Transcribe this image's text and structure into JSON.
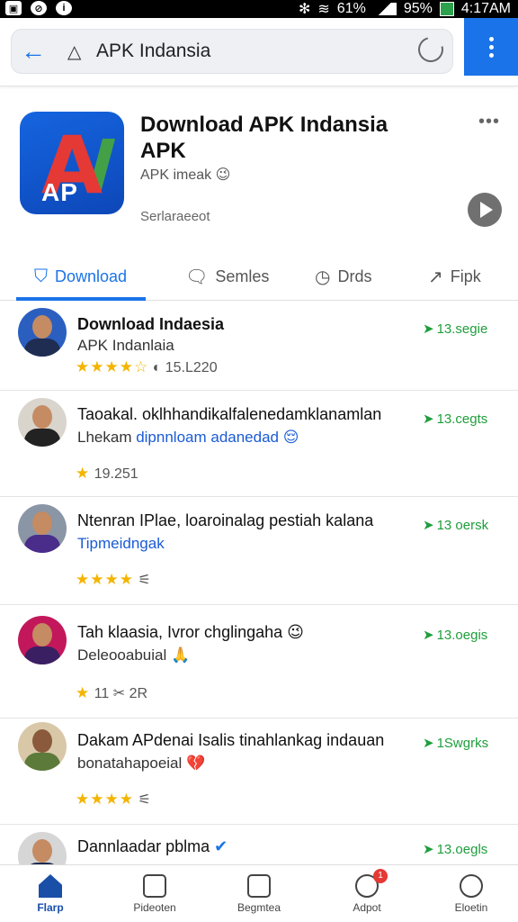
{
  "status_bar": {
    "battery_left": "61%",
    "battery": "95%",
    "time": "4:17AM"
  },
  "urlbar": {
    "url": "APK Indansia"
  },
  "app": {
    "title": "Download APK Indansia APK",
    "subtitle": "APK imeak 😉",
    "developer": "Serlaraeeot",
    "logo_text": "AP"
  },
  "tabs": [
    {
      "label": "Download"
    },
    {
      "label": "Semles"
    },
    {
      "label": "Drds"
    },
    {
      "label": "Fipk"
    }
  ],
  "list": [
    {
      "title": "Download Indaesia",
      "subtitle": "APK Indanlaia",
      "subtitle_blue": "",
      "stars": "★★★★☆",
      "rating": "◐ 15.L220",
      "count": "13.segie"
    },
    {
      "title": "Taoakal. oklhhandikalfalenedamklanamlan",
      "subtitle": "Lhekam ",
      "subtitle_blue": "dipnnloam adanedad 😌",
      "stars": "★",
      "rating": "19.251",
      "count": "13.cegts"
    },
    {
      "title": "Ntenran IPlae, loaroinalag pestiah kalana",
      "subtitle": "",
      "subtitle_blue": "Tipmeidngak",
      "stars": "★★★★",
      "rating": "⚟",
      "count": "13 oersk"
    },
    {
      "title": "Tah klaasia, Ivror chglingaha 😉",
      "subtitle": "Deleooabuial 🙏",
      "subtitle_blue": "",
      "stars": "★",
      "rating": "11 ✂ 2R",
      "count": "13.oegis"
    },
    {
      "title": "Dakam APdenai Isalis tinahlankag indauan",
      "subtitle": "bonatahapoeial 💔",
      "subtitle_blue": "",
      "stars": "★★★★",
      "rating": "⚟",
      "count": "1Swgrks"
    },
    {
      "title": "Dannlaadar pblma",
      "subtitle": "",
      "subtitle_blue": "",
      "stars": "",
      "rating": "",
      "count": "13.oegls"
    }
  ],
  "bottom_nav": [
    {
      "label": "Flarp",
      "badge": ""
    },
    {
      "label": "Pideoten",
      "badge": ""
    },
    {
      "label": "Begmtea",
      "badge": ""
    },
    {
      "label": "Adpot",
      "badge": "1"
    },
    {
      "label": "Eloetin",
      "badge": ""
    }
  ],
  "colors": {
    "accent": "#1a73e8",
    "count_green": "#1e9e3c",
    "star": "#f4b400"
  },
  "icons": [
    "back-arrow-icon",
    "warning-icon",
    "reload-icon",
    "menu-dots-icon",
    "play-icon",
    "download-icon",
    "comment-icon",
    "clock-icon",
    "share-icon",
    "home-icon",
    "face-icon",
    "list-icon",
    "bell-icon",
    "person-icon"
  ]
}
